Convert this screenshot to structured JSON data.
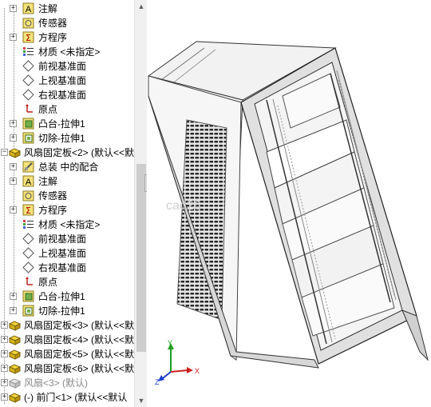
{
  "tree": {
    "items": [
      {
        "label": "注解",
        "icon": "annotation-icon"
      },
      {
        "label": "传感器",
        "icon": "sensor-icon"
      },
      {
        "label": "方程序",
        "icon": "equation-icon"
      },
      {
        "label": "材质 <未指定>",
        "icon": "material-icon"
      },
      {
        "label": "前视基准面",
        "icon": "plane-icon"
      },
      {
        "label": "上视基准面",
        "icon": "plane-icon"
      },
      {
        "label": "右视基准面",
        "icon": "plane-icon"
      },
      {
        "label": "原点",
        "icon": "origin-icon"
      },
      {
        "label": "凸台-拉伸1",
        "icon": "extrude-boss-icon"
      },
      {
        "label": "切除-拉伸1",
        "icon": "extrude-cut-icon"
      },
      {
        "label": "风扇固定板<2> (默认<<默",
        "icon": "part-icon"
      },
      {
        "label": "总装 中的配合",
        "icon": "mates-icon"
      },
      {
        "label": "注解",
        "icon": "annotation-icon"
      },
      {
        "label": "传感器",
        "icon": "sensor-icon"
      },
      {
        "label": "方程序",
        "icon": "equation-icon"
      },
      {
        "label": "材质 <未指定>",
        "icon": "material-icon"
      },
      {
        "label": "前视基准面",
        "icon": "plane-icon"
      },
      {
        "label": "上视基准面",
        "icon": "plane-icon"
      },
      {
        "label": "右视基准面",
        "icon": "plane-icon"
      },
      {
        "label": "原点",
        "icon": "origin-icon"
      },
      {
        "label": "凸台-拉伸1",
        "icon": "extrude-boss-icon"
      },
      {
        "label": "切除-拉伸1",
        "icon": "extrude-cut-icon"
      },
      {
        "label": "风扇固定板<3> (默认<<默",
        "icon": "part-icon"
      },
      {
        "label": "风扇固定板<4> (默认<<默",
        "icon": "part-icon"
      },
      {
        "label": "风扇固定板<5> (默认<<默",
        "icon": "part-icon"
      },
      {
        "label": "风扇固定板<6> (默认<<默",
        "icon": "part-icon"
      },
      {
        "label": "风扇<3> (默认)",
        "icon": "part-suppressed-icon"
      },
      {
        "label": "(-) 前门<1> (默认<<默认",
        "icon": "part-icon"
      }
    ]
  },
  "triad": {
    "x": "X",
    "y": "Y",
    "z": "Z"
  },
  "watermark": "cad26",
  "colors": {
    "part_yellow": "#f2d23a",
    "triad_x": "#d02020",
    "triad_y": "#20a020",
    "triad_z": "#2040d0"
  }
}
